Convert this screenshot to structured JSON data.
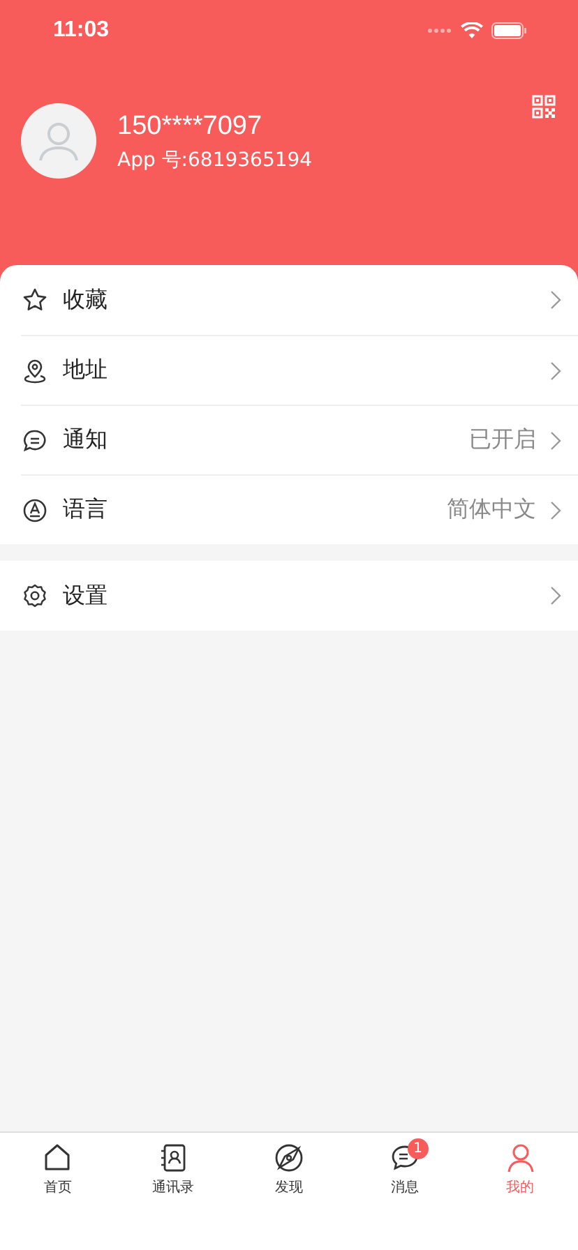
{
  "status_bar": {
    "time": "11:03"
  },
  "profile": {
    "phone": "150****7097",
    "app_id": "App 号:6819365194"
  },
  "menu_groups": [
    {
      "items": [
        {
          "label": "收藏"
        },
        {
          "label": "地址"
        },
        {
          "label": "通知",
          "value": "已开启"
        },
        {
          "label": "语言",
          "value": "简体中文"
        }
      ]
    },
    {
      "items": [
        {
          "label": "设置"
        }
      ]
    }
  ],
  "tab_bar": [
    {
      "label": "首页",
      "selected": false
    },
    {
      "label": "通讯录",
      "selected": false
    },
    {
      "label": "发现",
      "selected": false
    },
    {
      "label": "消息",
      "selected": false,
      "badge": "1"
    },
    {
      "label": "我的",
      "selected": true
    }
  ]
}
